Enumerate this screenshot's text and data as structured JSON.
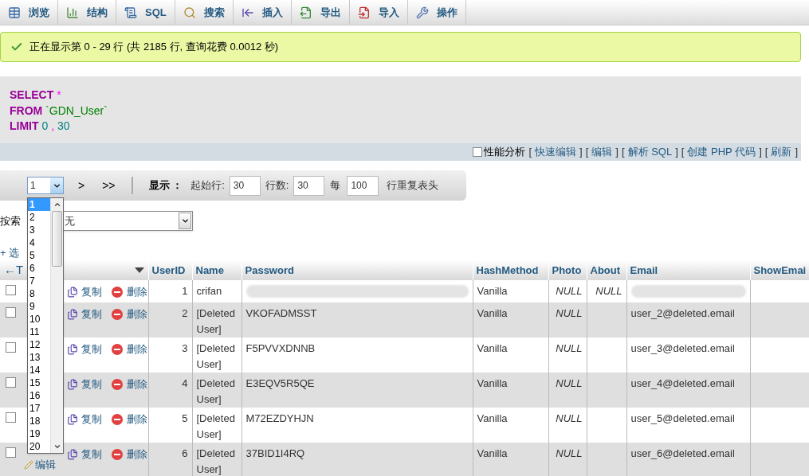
{
  "toolbar": {
    "tabs": [
      {
        "label": "浏览",
        "selected": false
      },
      {
        "label": "结构",
        "selected": false
      },
      {
        "label": "SQL",
        "selected": false
      },
      {
        "label": "搜索",
        "selected": false
      },
      {
        "label": "插入",
        "selected": false
      },
      {
        "label": "导出",
        "selected": false
      },
      {
        "label": "导入",
        "selected": false
      },
      {
        "label": "操作",
        "selected": false
      }
    ]
  },
  "message": "正在显示第 0 - 29 行 (共 2185 行, 查询花费 0.0012 秒)",
  "sql": {
    "lines": [
      {
        "keyword": "SELECT",
        "tokens": [
          {
            "kind": "operator",
            "text": "*"
          }
        ]
      },
      {
        "keyword": "FROM",
        "tokens": [
          {
            "kind": "identifier",
            "text": "`GDN_User`"
          }
        ]
      },
      {
        "keyword": "LIMIT",
        "tokens": [
          {
            "kind": "number",
            "text": "0"
          },
          {
            "kind": "operator",
            "text": ","
          },
          {
            "kind": "number",
            "text": "30"
          }
        ]
      }
    ],
    "profiling": {
      "label": "性能分析",
      "checked": false
    },
    "bracket_open": "[",
    "bracket_close": "]",
    "links": [
      "快速编辑",
      "编辑",
      "解析 SQL",
      "创建 PHP 代码",
      "刷新"
    ]
  },
  "nav": {
    "page_select": {
      "value": "1",
      "open": true,
      "options": [
        {
          "label": "1",
          "selected": true
        },
        {
          "label": "2",
          "selected": false
        },
        {
          "label": "3",
          "selected": false
        },
        {
          "label": "4",
          "selected": false
        },
        {
          "label": "5",
          "selected": false
        },
        {
          "label": "6",
          "selected": false
        },
        {
          "label": "7",
          "selected": false
        },
        {
          "label": "8",
          "selected": false
        },
        {
          "label": "9",
          "selected": false
        },
        {
          "label": "10",
          "selected": false
        },
        {
          "label": "11",
          "selected": false
        },
        {
          "label": "12",
          "selected": false
        },
        {
          "label": "13",
          "selected": false
        },
        {
          "label": "14",
          "selected": false
        },
        {
          "label": "15",
          "selected": false
        },
        {
          "label": "16",
          "selected": false
        },
        {
          "label": "17",
          "selected": false
        },
        {
          "label": "18",
          "selected": false
        },
        {
          "label": "19",
          "selected": false
        },
        {
          "label": "20",
          "selected": false
        }
      ]
    },
    "next": ">",
    "last": ">>",
    "show_label": "显示 ：",
    "start_label": "起始行:",
    "start_value": "30",
    "rows_label": "行数:",
    "rows_value": "30",
    "every_label": "每",
    "repeat_value": "100",
    "repeat_label": "行重复表头"
  },
  "index_sort": {
    "label": "按索",
    "value": "无"
  },
  "options_link": "+ 选",
  "table": {
    "lead": "←T",
    "columns": [
      "UserID",
      "Name",
      "Password",
      "HashMethod",
      "Photo",
      "About",
      "Email",
      "ShowEmai"
    ],
    "rows": [
      {
        "checked": false,
        "copy": "复制",
        "delete": "删除",
        "cells": [
          {
            "kind": "number",
            "text": "1"
          },
          {
            "kind": "text",
            "text": "crifan"
          },
          {
            "kind": "blurred"
          },
          {
            "kind": "text",
            "text": "Vanilla"
          },
          {
            "kind": "null",
            "text": "NULL"
          },
          {
            "kind": "null",
            "text": "NULL"
          },
          {
            "kind": "blurred"
          },
          {
            "kind": "empty"
          }
        ]
      },
      {
        "checked": false,
        "copy": "复制",
        "delete": "删除",
        "cells": [
          {
            "kind": "number",
            "text": "2"
          },
          {
            "kind": "text",
            "text": "[Deleted User]"
          },
          {
            "kind": "text",
            "text": "VKOFADMSST"
          },
          {
            "kind": "text",
            "text": "Vanilla"
          },
          {
            "kind": "null",
            "text": "NULL"
          },
          {
            "kind": "empty"
          },
          {
            "kind": "text",
            "text": "user_2@deleted.email"
          },
          {
            "kind": "empty"
          }
        ]
      },
      {
        "checked": false,
        "copy": "复制",
        "delete": "删除",
        "cells": [
          {
            "kind": "number",
            "text": "3"
          },
          {
            "kind": "text",
            "text": "[Deleted User]"
          },
          {
            "kind": "text",
            "text": "F5PVVXDNNB"
          },
          {
            "kind": "text",
            "text": "Vanilla"
          },
          {
            "kind": "null",
            "text": "NULL"
          },
          {
            "kind": "empty"
          },
          {
            "kind": "text",
            "text": "user_3@deleted.email"
          },
          {
            "kind": "empty"
          }
        ]
      },
      {
        "checked": false,
        "copy": "复制",
        "delete": "删除",
        "cells": [
          {
            "kind": "number",
            "text": "4"
          },
          {
            "kind": "text",
            "text": "[Deleted User]"
          },
          {
            "kind": "text",
            "text": "E3EQV5R5QE"
          },
          {
            "kind": "text",
            "text": "Vanilla"
          },
          {
            "kind": "null",
            "text": "NULL"
          },
          {
            "kind": "empty"
          },
          {
            "kind": "text",
            "text": "user_4@deleted.email"
          },
          {
            "kind": "empty"
          }
        ]
      },
      {
        "checked": false,
        "copy": "复制",
        "delete": "删除",
        "cells": [
          {
            "kind": "number",
            "text": "5"
          },
          {
            "kind": "text",
            "text": "[Deleted User]"
          },
          {
            "kind": "text",
            "text": "M72EZDYHJN"
          },
          {
            "kind": "text",
            "text": "Vanilla"
          },
          {
            "kind": "null",
            "text": "NULL"
          },
          {
            "kind": "empty"
          },
          {
            "kind": "text",
            "text": "user_5@deleted.email"
          },
          {
            "kind": "empty"
          }
        ]
      },
      {
        "checked": false,
        "edit": "编辑",
        "copy": "复制",
        "delete": "删除",
        "cells": [
          {
            "kind": "number",
            "text": "6"
          },
          {
            "kind": "text",
            "text": "[Deleted User]"
          },
          {
            "kind": "text",
            "text": "37BID1I4RQ"
          },
          {
            "kind": "text",
            "text": "Vanilla"
          },
          {
            "kind": "null",
            "text": "NULL"
          },
          {
            "kind": "empty"
          },
          {
            "kind": "text",
            "text": "user_6@deleted.email"
          },
          {
            "kind": "empty"
          }
        ]
      }
    ]
  }
}
